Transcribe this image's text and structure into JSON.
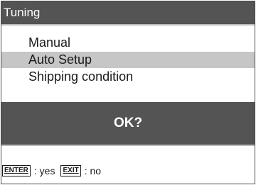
{
  "window": {
    "title": "Tuning"
  },
  "menu": {
    "items": [
      {
        "label": "Manual",
        "selected": false
      },
      {
        "label": "Auto Setup",
        "selected": true
      },
      {
        "label": "Shipping condition",
        "selected": false
      }
    ]
  },
  "confirm": {
    "prompt": "OK?"
  },
  "footer": {
    "enter_key": "ENTER",
    "enter_action": ": yes",
    "exit_key": "EXIT",
    "exit_action": ": no"
  },
  "colors": {
    "titlebar_bg": "#545454",
    "selected_bg": "#c6c6c6",
    "banner_bg": "#545454"
  }
}
